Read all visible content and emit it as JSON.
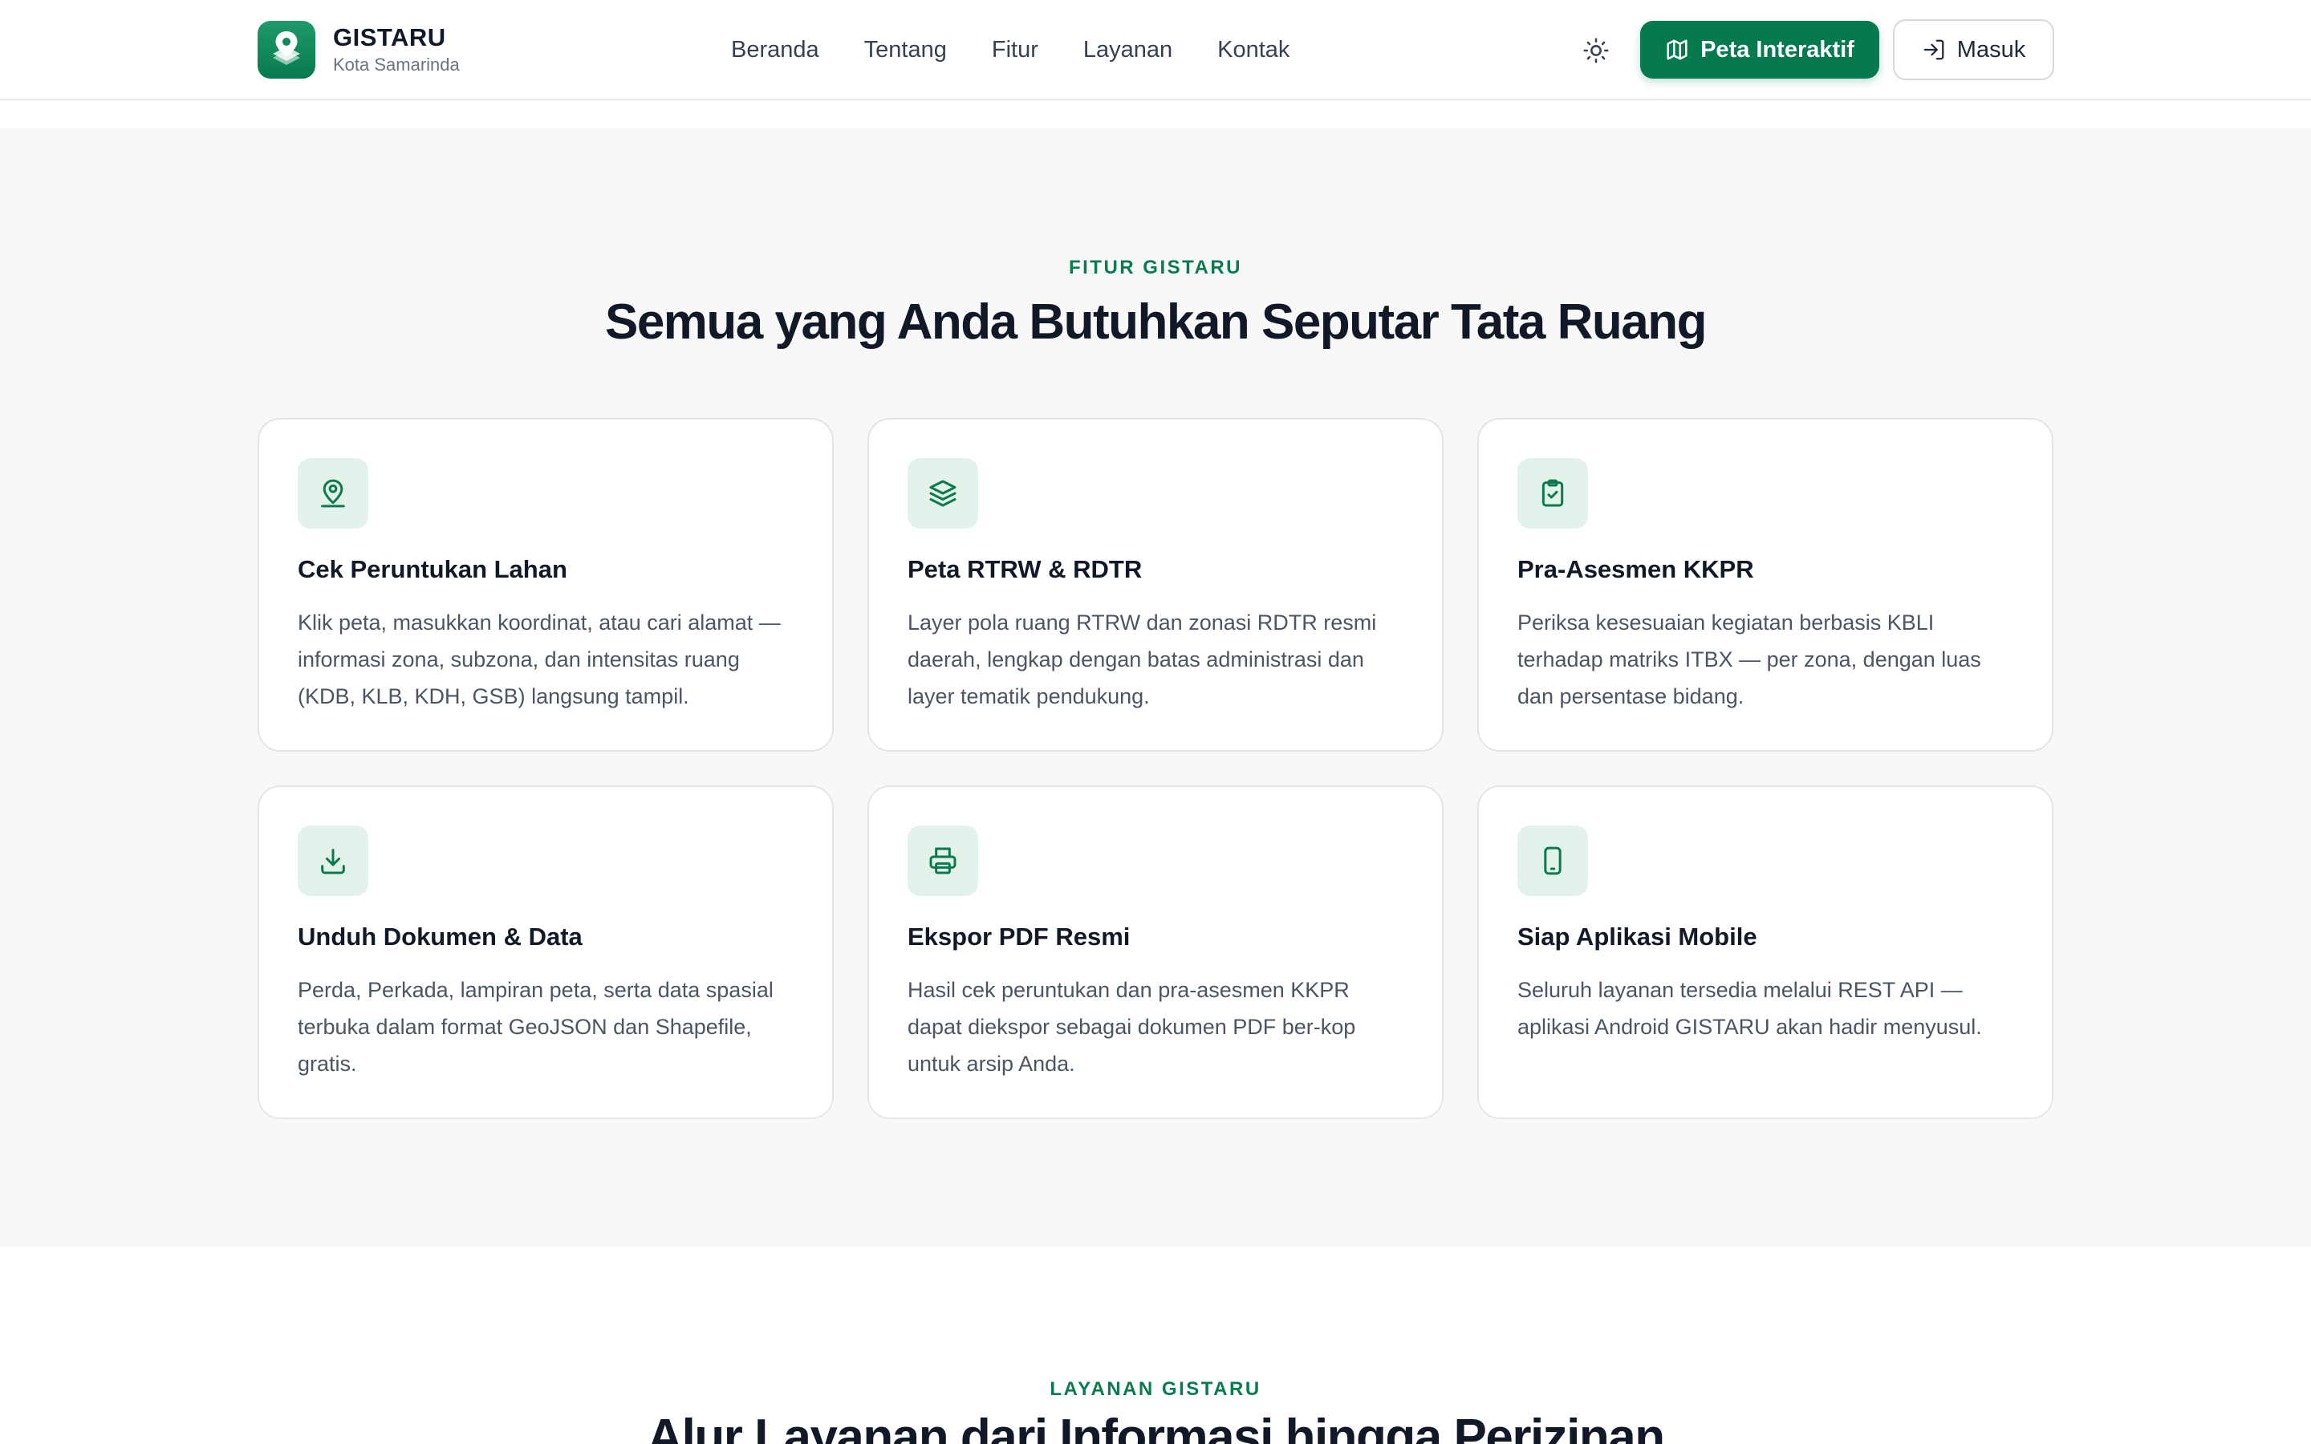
{
  "header": {
    "brand_name": "GISTARU",
    "brand_subtitle": "Kota Samarinda",
    "nav": [
      "Beranda",
      "Tentang",
      "Fitur",
      "Layanan",
      "Kontak"
    ],
    "map_button": "Peta Interaktif",
    "login_button": "Masuk",
    "icons": {
      "logo": "map-pin-layers-icon",
      "theme": "sun-icon",
      "map": "map-icon",
      "login": "login-icon"
    }
  },
  "features": {
    "eyebrow": "FITUR GISTARU",
    "title": "Semua yang Anda Butuhkan Seputar Tata Ruang",
    "cards": [
      {
        "icon": "map-pin-user-icon",
        "title": "Cek Peruntukan Lahan",
        "description": "Klik peta, masukkan koordinat, atau cari alamat — informasi zona, subzona, dan intensitas ruang (KDB, KLB, KDH, GSB) langsung tampil."
      },
      {
        "icon": "layers-icon",
        "title": "Peta RTRW & RDTR",
        "description": "Layer pola ruang RTRW dan zonasi RDTR resmi daerah, lengkap dengan batas administrasi dan layer tematik pendukung."
      },
      {
        "icon": "clipboard-check-icon",
        "title": "Pra-Asesmen KKPR",
        "description": "Periksa kesesuaian kegiatan berbasis KBLI terhadap matriks ITBX — per zona, dengan luas dan persentase bidang."
      },
      {
        "icon": "download-icon",
        "title": "Unduh Dokumen & Data",
        "description": "Perda, Perkada, lampiran peta, serta data spasial terbuka dalam format GeoJSON dan Shapefile, gratis."
      },
      {
        "icon": "printer-icon",
        "title": "Ekspor PDF Resmi",
        "description": "Hasil cek peruntukan dan pra-asesmen KKPR dapat diekspor sebagai dokumen PDF ber-kop untuk arsip Anda."
      },
      {
        "icon": "smartphone-icon",
        "title": "Siap Aplikasi Mobile",
        "description": "Seluruh layanan tersedia melalui REST API — aplikasi Android GISTARU akan hadir menyusul."
      }
    ]
  },
  "services": {
    "eyebrow": "LAYANAN GISTARU",
    "title": "Alur Layanan dari Informasi hingga Perizinan"
  },
  "colors": {
    "accent": "#047a4e",
    "accent_text": "#0a7a4f",
    "icon_bg": "#e3f2ea",
    "section_bg": "#f8f8f8"
  }
}
